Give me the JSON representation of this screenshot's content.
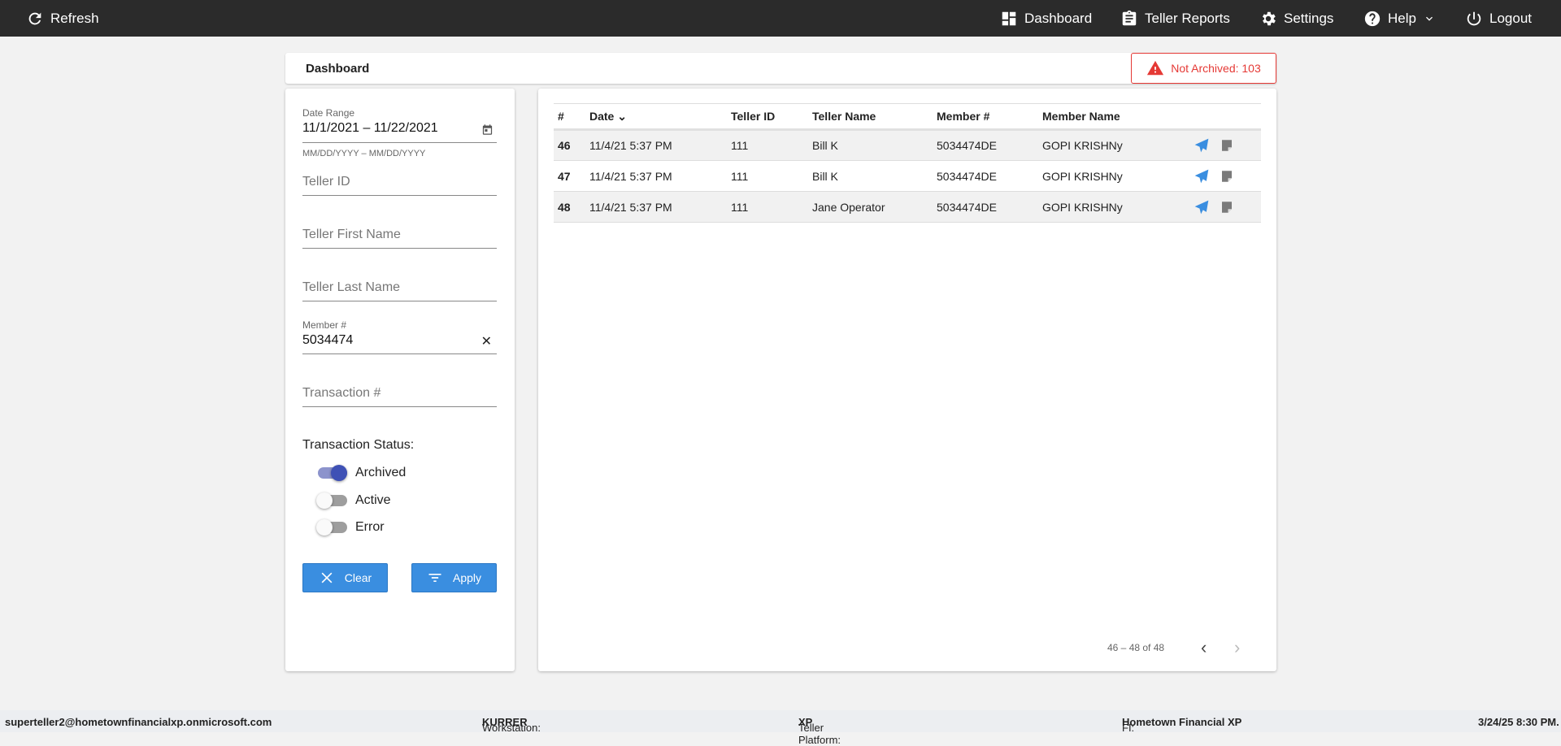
{
  "topbar": {
    "refresh": "Refresh",
    "dashboard": "Dashboard",
    "teller_reports": "Teller Reports",
    "settings": "Settings",
    "help": "Help",
    "logout": "Logout"
  },
  "page": {
    "title": "Dashboard",
    "not_archived_label": "Not Archived: 103"
  },
  "filters": {
    "date_range_label": "Date Range",
    "date_range_value": "11/1/2021 – 11/22/2021",
    "date_hint": "MM/DD/YYYY – MM/DD/YYYY",
    "teller_id_placeholder": "Teller ID",
    "first_name_placeholder": "Teller First Name",
    "last_name_placeholder": "Teller Last Name",
    "member_label": "Member #",
    "member_value": "5034474",
    "transaction_placeholder": "Transaction #",
    "status_label": "Transaction Status:",
    "statuses": [
      {
        "label": "Archived",
        "on": true
      },
      {
        "label": "Active",
        "on": false
      },
      {
        "label": "Error",
        "on": false
      }
    ],
    "clear": "Clear",
    "apply": "Apply"
  },
  "table": {
    "headers": [
      "#",
      "Date",
      "Teller ID",
      "Teller Name",
      "Member #",
      "Member Name"
    ],
    "rows": [
      {
        "n": "46",
        "date": "11/4/21 5:37 PM",
        "teller_id": "111",
        "teller_name": "Bill K",
        "member": "5034474DE",
        "member_name": "GOPI KRISHNy"
      },
      {
        "n": "47",
        "date": "11/4/21 5:37 PM",
        "teller_id": "111",
        "teller_name": "Bill K",
        "member": "5034474DE",
        "member_name": "GOPI KRISHNy"
      },
      {
        "n": "48",
        "date": "11/4/21 5:37 PM",
        "teller_id": "111",
        "teller_name": "Jane Operator",
        "member": "5034474DE",
        "member_name": "GOPI KRISHNy"
      }
    ]
  },
  "pagination": {
    "range": "46 – 48 of 48"
  },
  "footer": {
    "user": "superteller2@hometownfinancialxp.onmicrosoft.com",
    "workstation_label": "Workstation:",
    "workstation": "KURRER",
    "platform_label": "Teller Platform:",
    "platform": "XP",
    "fi_label": "FI:",
    "fi": "Hometown Financial XP",
    "datetime": "3/24/25 8:30 PM."
  },
  "colors": {
    "accent": "#3a8ee0",
    "alert": "#e53935",
    "toggle": "#3f51b5"
  }
}
